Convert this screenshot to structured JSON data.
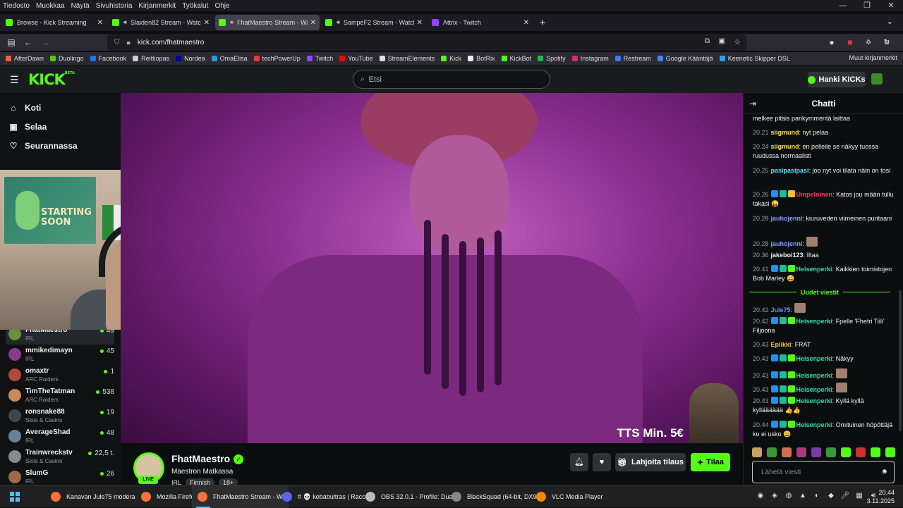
{
  "firefox": {
    "menu": [
      "Tiedosto",
      "Muokkaa",
      "Näytä",
      "Sivuhistoria",
      "Kirjanmerkit",
      "Työkalut",
      "Ohje"
    ],
    "tabs": [
      {
        "label": "Browse - Kick Streaming",
        "color": "#53fc18"
      },
      {
        "label": "Slaiden82 Stream - Watch Live",
        "color": "#53fc18"
      },
      {
        "label": "FhatMaestro Stream - Watch",
        "color": "#53fc18"
      },
      {
        "label": "SampeF2 Stream - Watch Live",
        "color": "#53fc18"
      },
      {
        "label": "Attrix - Twitch",
        "color": "#9146ff"
      }
    ],
    "url": "kick.com/fhatmaestro",
    "bookmarks": [
      {
        "label": "AfterDawn",
        "color": "#e63"
      },
      {
        "label": "Duolingo",
        "color": "#58cc02"
      },
      {
        "label": "Facebook",
        "color": "#1877f2"
      },
      {
        "label": "Reittiopas",
        "color": "#ccc"
      },
      {
        "label": "Nordea",
        "color": "#0000a0"
      },
      {
        "label": "OmaElisa",
        "color": "#2a9cd8"
      },
      {
        "label": "techPowerUp",
        "color": "#e33"
      },
      {
        "label": "Twitch",
        "color": "#9146ff"
      },
      {
        "label": "YouTube",
        "color": "#f00"
      },
      {
        "label": "StreamElements",
        "color": "#ddd"
      },
      {
        "label": "Kick",
        "color": "#53fc18"
      },
      {
        "label": "BotRix",
        "color": "#eee"
      },
      {
        "label": "KickBot",
        "color": "#53fc18"
      },
      {
        "label": "Spotify",
        "color": "#1db954"
      },
      {
        "label": "Instagram",
        "color": "#d62976"
      },
      {
        "label": "Restream",
        "color": "#3a7bfd"
      },
      {
        "label": "Google Kääntäjä",
        "color": "#4285f4"
      },
      {
        "label": "Keenetic Skipper DSL",
        "color": "#2aa4e0"
      }
    ],
    "bookmarks_other": "Muut kirjanmerkit"
  },
  "kick": {
    "logo": "KICK",
    "logo_tag": "BETA",
    "search_placeholder": "Etsi",
    "get_kicks": "Hanki KICKs",
    "nav": [
      {
        "label": "Koti",
        "icon": "home-icon"
      },
      {
        "label": "Selaa",
        "icon": "browse-icon"
      },
      {
        "label": "Seurannassa",
        "icon": "heart-icon"
      }
    ],
    "channels": [
      {
        "name": "FhatMaestro",
        "category": "IRL",
        "viewers": "49",
        "color": "#6a8f3a"
      },
      {
        "name": "mmikedimayn",
        "category": "IRL",
        "viewers": "45",
        "color": "#8c3a8c"
      },
      {
        "name": "omaxtr",
        "category": "ARC Raiders",
        "viewers": "1",
        "color": "#b04a3a"
      },
      {
        "name": "TimTheTatman",
        "category": "ARC Raiders",
        "viewers": "538",
        "color": "#c98a5a"
      },
      {
        "name": "ronsnake88",
        "category": "Slots & Casino",
        "viewers": "19",
        "color": "#444"
      },
      {
        "name": "AverageShad",
        "category": "IRL",
        "viewers": "48",
        "color": "#6a7f9a"
      },
      {
        "name": "Trainwreckstv",
        "category": "Slots & Casino",
        "viewers": "22,5 t.",
        "color": "#8a8a8a"
      },
      {
        "name": "SlumG",
        "category": "IRL",
        "viewers": "26",
        "color": "#9a6a4a"
      }
    ],
    "webcam_poster": "STARTING SOON",
    "tts_label": "TTS Min. 5€",
    "streamer": {
      "name": "FhatMaestro",
      "title": "Maestron Matkassa",
      "tags": [
        "IRL",
        "Finnish",
        "18+"
      ],
      "live": "LIVE",
      "gift_label": "Lahjoita tilaus",
      "subscribe_label": "Tilaa"
    },
    "chat": {
      "title": "Chatti",
      "new_messages": "Uudet viestit",
      "input_placeholder": "Lähetä viesti",
      "messages": [
        {
          "time": "",
          "user": "",
          "text": "melkee pitäis parikymmentä laittaa",
          "color": "#eee",
          "badges": []
        },
        {
          "time": "20.21",
          "user": "siigmund",
          "text": "nyt pelaa",
          "color": "#f5e15a",
          "badges": []
        },
        {
          "time": "20.24",
          "user": "siigmund",
          "text": "en pelleile se näkyy tuossa ruudussa normaalisti",
          "color": "#f5e15a",
          "badges": []
        },
        {
          "time": "20.25",
          "user": "pasipasipasi",
          "text": "joo nyt voi tilata näin on tosi",
          "color": "#5ce0f5",
          "badges": []
        },
        {
          "time": "20.26",
          "user": "Umpeloinen",
          "text": "Katos jou mään tullu takasi 😜",
          "color": "#ff3a5a",
          "badges": [
            "#1e90ff",
            "#1abc9c",
            "#f0c040"
          ]
        },
        {
          "time": "20.28",
          "user": "jauhojenni",
          "text": "kiuruveden viimeinen puritaani",
          "color": "#8a9cff",
          "badges": []
        },
        {
          "time": "20.28",
          "user": "jauhojenni",
          "text": "",
          "color": "#8a9cff",
          "badges": []
        },
        {
          "time": "20.36",
          "user": "jakeboi123",
          "text": "Iltaa",
          "color": "#eee",
          "badges": []
        },
        {
          "time": "20.41",
          "user": "Heisenperki",
          "text": "Kaikkien toimistojen Bob Marley 😄",
          "color": "#2ee0a8",
          "badges": [
            "#1e90ff",
            "#1abc9c",
            "#53fc18"
          ]
        },
        {
          "time": "20.42",
          "user": "Jule75",
          "text": "",
          "color": "#5a9cff",
          "badges": []
        },
        {
          "time": "20.42",
          "user": "Heisenperki",
          "text": "Fpelle 'Fhetri Tiili' Filjoona",
          "color": "#2ee0a8",
          "badges": [
            "#1e90ff",
            "#1abc9c",
            "#53fc18"
          ]
        },
        {
          "time": "20.43",
          "user": "Epiikki",
          "text": "FRAT",
          "color": "#f0c040",
          "badges": []
        },
        {
          "time": "20.43",
          "user": "Heisenperki",
          "text": "Näkyy",
          "color": "#2ee0a8",
          "badges": [
            "#1e90ff",
            "#1abc9c",
            "#53fc18"
          ]
        },
        {
          "time": "20.43",
          "user": "Heisenperki",
          "text": "",
          "color": "#2ee0a8",
          "badges": [
            "#1e90ff",
            "#1abc9c",
            "#53fc18"
          ]
        },
        {
          "time": "20.43",
          "user": "Heisenperki",
          "text": "",
          "color": "#2ee0a8",
          "badges": [
            "#1e90ff",
            "#1abc9c",
            "#53fc18"
          ]
        },
        {
          "time": "20.43",
          "user": "Heisenperki",
          "text": "Kyllä kyllä kyllääääää 👍👍",
          "color": "#2ee0a8",
          "badges": [
            "#1e90ff",
            "#1abc9c",
            "#53fc18"
          ]
        },
        {
          "time": "20.44",
          "user": "Heisenperki",
          "text": "Omituinen höpöttäjä ku ei usko 😄",
          "color": "#2ee0a8",
          "badges": [
            "#1e90ff",
            "#1abc9c",
            "#53fc18"
          ]
        }
      ]
    }
  },
  "taskbar": {
    "apps": [
      {
        "label": "Kanavan Jule75 modera",
        "color": "#ff7139"
      },
      {
        "label": "Mozilla Firefox",
        "color": "#ff7139"
      },
      {
        "label": "FhatMaestro Stream - W",
        "color": "#ff7139"
      },
      {
        "label": "# 💀 kebabultras | Racco",
        "color": "#5865f2"
      },
      {
        "label": "OBS 32.0.1 - Profile: Dua",
        "color": "#bbb"
      },
      {
        "label": "BlackSquad (64-bit, DX9",
        "color": "#888"
      },
      {
        "label": "VLC Media Player",
        "color": "#f80"
      }
    ],
    "time": "20.44",
    "date": "3.11.2025"
  }
}
